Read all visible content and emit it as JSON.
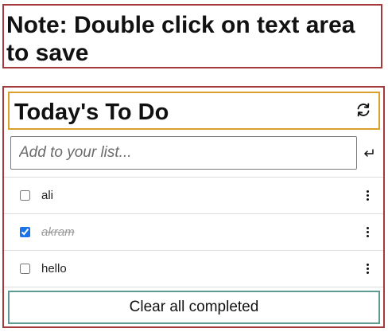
{
  "note": {
    "text_line1": "Note: Double click on text area",
    "text_line2": "to save"
  },
  "todo": {
    "title": "Today's To Do",
    "input_placeholder": "Add to your list...",
    "items": [
      {
        "label": "ali",
        "checked": false
      },
      {
        "label": "akram",
        "checked": true
      },
      {
        "label": "hello",
        "checked": false
      }
    ],
    "clear_label": "Clear all completed"
  },
  "icons": {
    "refresh": "refresh-icon",
    "enter": "enter-return-icon",
    "menu": "more-vertical-icon"
  },
  "colors": {
    "outer_border": "#a23a3c",
    "header_border": "#d9a12b",
    "clear_border": "#5e9b93",
    "checkbox_accent": "#1a73e8"
  }
}
